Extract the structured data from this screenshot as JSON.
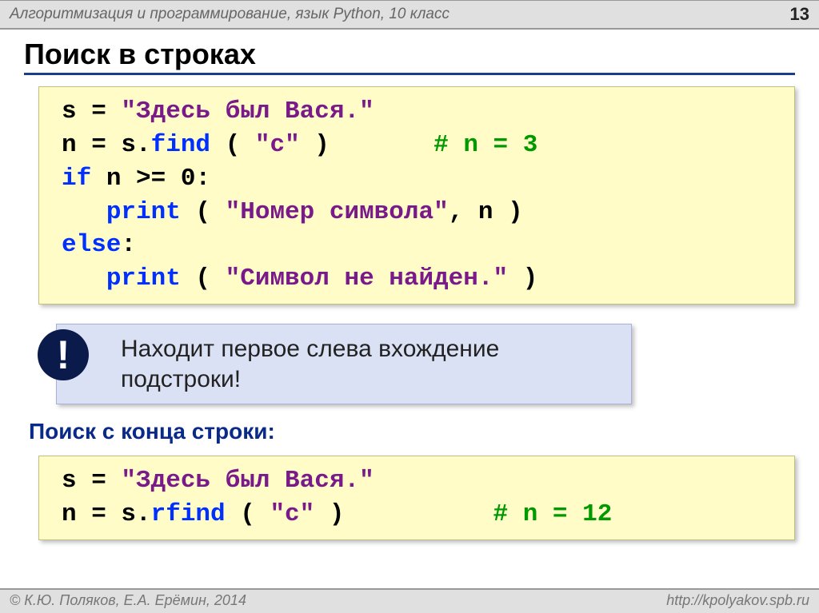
{
  "header": {
    "course": "Алгоритмизация и программирование, язык Python, 10 класс",
    "page": "13"
  },
  "title": "Поиск в строках",
  "code1": {
    "l1_a": "s = ",
    "l1_str": "\"Здесь был Вася.\"",
    "l2_a": "n = s.",
    "l2_fn": "find",
    "l2_b": " ( ",
    "l2_str": "\"с\"",
    "l2_c": " )       ",
    "l2_cmt": "# n = 3",
    "l3_kw": "if",
    "l3_b": " n >= ",
    "l3_num": "0",
    "l3_c": ":",
    "l4_pad": "   ",
    "l4_fn": "print",
    "l4_b": " ( ",
    "l4_str": "\"Номер символа\"",
    "l4_c": ", n )",
    "l5_kw": "else",
    "l5_b": ":",
    "l6_pad": "   ",
    "l6_fn": "print",
    "l6_b": " ( ",
    "l6_str": "\"Символ не найден.\"",
    "l6_c": " )"
  },
  "info": {
    "mark": "!",
    "text": "Находит первое слева вхождение подстроки!"
  },
  "subhead": "Поиск с конца строки:",
  "code2": {
    "l1_a": "s = ",
    "l1_str": "\"Здесь был Вася.\"",
    "l2_a": "n = s.",
    "l2_fn": "rfind",
    "l2_b": " ( ",
    "l2_str": "\"с\"",
    "l2_c": " )          ",
    "l2_cmt": "# n = 12"
  },
  "footer": {
    "copyright": "© К.Ю. Поляков, Е.А. Ерёмин, 2014",
    "url": "http://kpolyakov.spb.ru"
  }
}
